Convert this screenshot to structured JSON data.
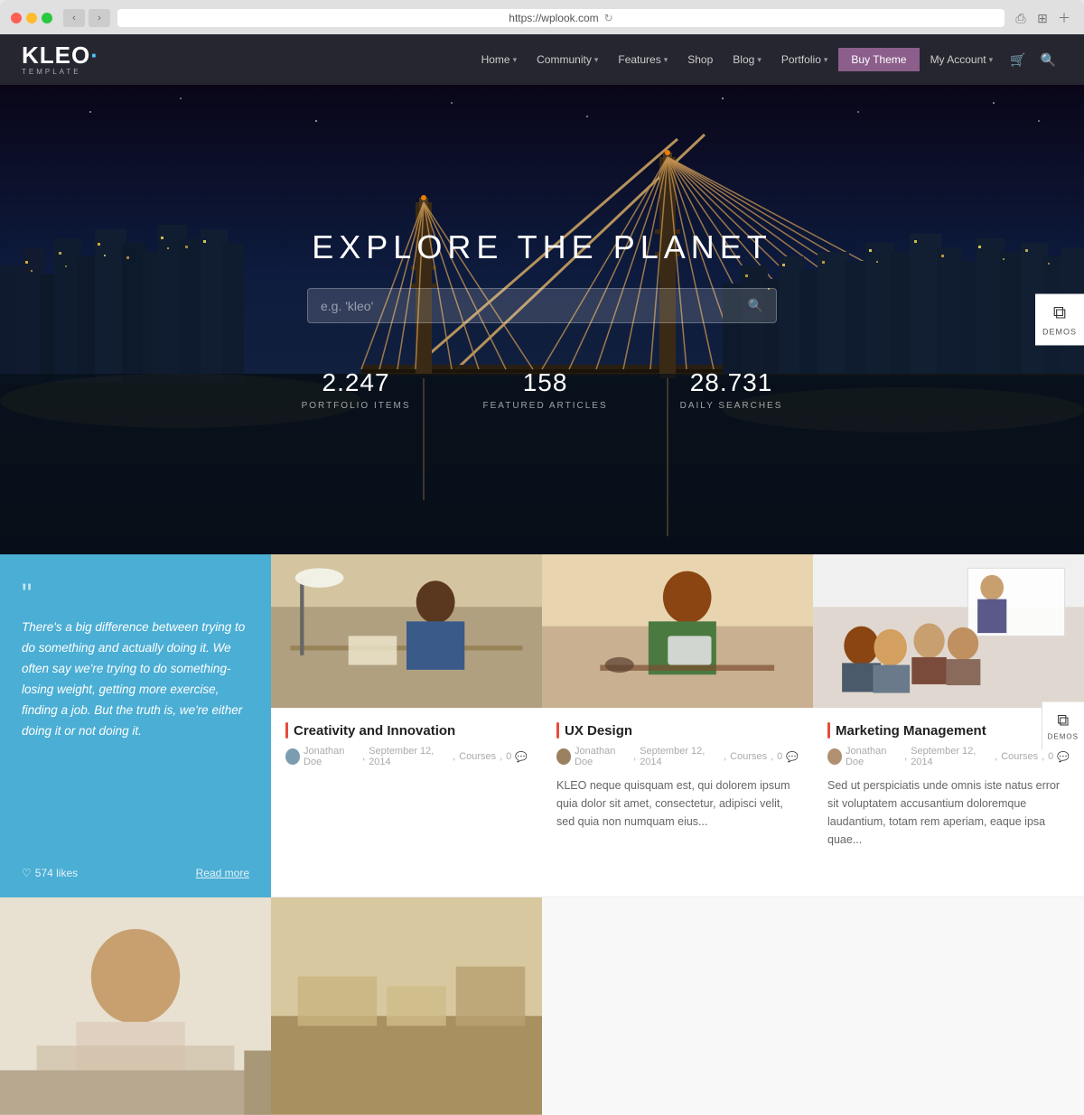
{
  "browser": {
    "url": "https://wplook.com",
    "reload_icon": "↻"
  },
  "header": {
    "logo_main": "KLEO",
    "logo_dot_color": "#4fc3f7",
    "logo_sub": "TEMPLATE",
    "nav": [
      {
        "label": "Home",
        "has_dropdown": true
      },
      {
        "label": "Community",
        "has_dropdown": true
      },
      {
        "label": "Features",
        "has_dropdown": true
      },
      {
        "label": "Shop",
        "has_dropdown": false
      },
      {
        "label": "Blog",
        "has_dropdown": true
      },
      {
        "label": "Portfolio",
        "has_dropdown": true
      },
      {
        "label": "Buy Theme",
        "is_cta": true
      },
      {
        "label": "My Account",
        "has_dropdown": true
      }
    ]
  },
  "hero": {
    "title": "EXPLORE THE PLANET",
    "search_placeholder": "e.g. 'kleo'",
    "stats": [
      {
        "number": "2.247",
        "label": "PORTFOLIO ITEMS"
      },
      {
        "number": "158",
        "label": "FEATURED ARTICLES"
      },
      {
        "number": "28.731",
        "label": "DAILY SEARCHES"
      }
    ],
    "demos_label": "DEMOS"
  },
  "content": {
    "quote": {
      "text": "There's a big difference between trying to do something and actually doing it. We often say we're trying to do something-losing weight, getting more exercise, finding a job. But the truth is, we're either doing it or not doing it.",
      "likes": "574 likes",
      "read_more": "Read more"
    },
    "cards": [
      {
        "title": "Creativity and Innovation",
        "author": "Jonathan Doe",
        "date": "September 12, 2014",
        "category": "Courses",
        "comments": "0",
        "excerpt": ""
      },
      {
        "title": "UX Design",
        "author": "Jonathan Doe",
        "date": "September 12, 2014",
        "category": "Courses",
        "comments": "0",
        "excerpt": "KLEO neque quisquam est, qui dolorem ipsum quia dolor sit amet, consectetur, adipisci velit, sed quia non numquam eius..."
      },
      {
        "title": "Marketing Management",
        "author": "Jonathan Doe",
        "date": "September 12, 2014",
        "category": "Courses",
        "comments": "0",
        "excerpt": "Sed ut perspiciatis unde omnis iste natus error sit voluptatem accusantium doloremque laudantium, totam rem aperiam, eaque ipsa quae..."
      }
    ]
  }
}
